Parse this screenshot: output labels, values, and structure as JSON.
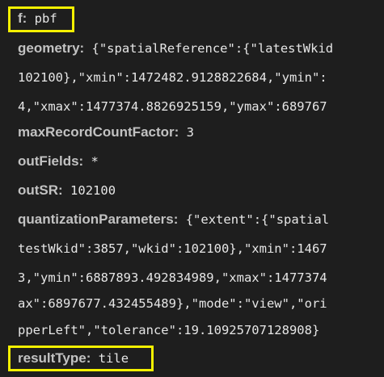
{
  "params": {
    "f": {
      "key": "f:",
      "value": " pbf"
    },
    "geometry": {
      "key": "geometry:",
      "value": " {\"spatialReference\":{\"latestWkid",
      "cont": [
        "102100},\"xmin\":1472482.9128822684,\"ymin\":",
        "4,\"xmax\":1477374.8826925159,\"ymax\":689767"
      ]
    },
    "maxRecordCountFactor": {
      "key": "maxRecordCountFactor:",
      "value": " 3"
    },
    "outFields": {
      "key": "outFields:",
      "value": " *"
    },
    "outSR": {
      "key": "outSR:",
      "value": " 102100"
    },
    "quantizationParameters": {
      "key": "quantizationParameters:",
      "value": " {\"extent\":{\"spatial",
      "cont": [
        "testWkid\":3857,\"wkid\":102100},\"xmin\":1467",
        "3,\"ymin\":6887893.492834989,\"xmax\":1477374",
        "ax\":6897677.432455489},\"mode\":\"view\",\"ori",
        "pperLeft\",\"tolerance\":19.10925707128908}"
      ]
    },
    "resultType": {
      "key": "resultType:",
      "value": " tile"
    }
  },
  "highlight_color": "#f4f000"
}
